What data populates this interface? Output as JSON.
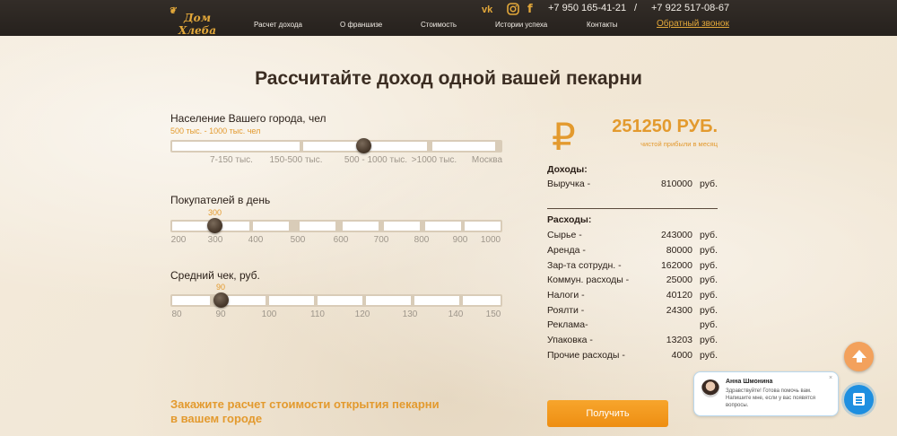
{
  "header": {
    "logo": {
      "text": "Дом Хлеба",
      "sub": ""
    },
    "nav": [
      "Расчет дохода",
      "О франшизе",
      "Стоимость",
      "Истории успеха",
      "Контакты"
    ],
    "social": [
      "vk-icon",
      "instagram-icon",
      "facebook-icon"
    ],
    "phone1": "+7 950 165-41-21",
    "separator": "/",
    "phone2": "+7 922 517-08-67",
    "callback": "Обратный звонок"
  },
  "title": "Рассчитайте доход одной вашей пекарни",
  "sliders": {
    "population": {
      "label": "Население Вашего города, чел",
      "selected": "500 тыс. - 1000 тыс. чел",
      "ticks": [
        "7-150 тыс.",
        "150-500 тыс.",
        "500 - 1000 тыс.",
        ">1000 тыс.",
        "Москва"
      ],
      "position_index": 2
    },
    "customers": {
      "label": "Покупателей в день",
      "selected": "300",
      "ticks": [
        "200",
        "300",
        "400",
        "500",
        "600",
        "700",
        "800",
        "900",
        "1000"
      ],
      "value": 300
    },
    "check": {
      "label": "Средний чек, руб.",
      "selected": "90",
      "ticks": [
        "80",
        "90",
        "100",
        "110",
        "120",
        "130",
        "140",
        "150"
      ],
      "value": 90
    }
  },
  "cta_text": "Закажите расчет стоимости открытия пекарни в вашем городе",
  "summary": {
    "currency_symbol": "₽",
    "profit": "251250 РУБ.",
    "profit_caption": "чистой прибыли в месяц",
    "income_title": "Доходы:",
    "income": [
      {
        "name": "Выручка -",
        "value": "810000",
        "cur": "руб."
      }
    ],
    "expenses_title": "Расходы:",
    "expenses": [
      {
        "name": "Сырье -",
        "value": "243000",
        "cur": "руб."
      },
      {
        "name": "Аренда -",
        "value": "80000",
        "cur": "руб."
      },
      {
        "name": "Зар-та сотрудн. -",
        "value": "162000",
        "cur": "руб."
      },
      {
        "name": "Коммун. расходы -",
        "value": "25000",
        "cur": "руб."
      },
      {
        "name": "Налоги -",
        "value": "40120",
        "cur": "руб."
      },
      {
        "name": "Роялти -",
        "value": "24300",
        "cur": "руб."
      },
      {
        "name": "Реклама-",
        "value": "",
        "cur": "руб."
      },
      {
        "name": "Упаковка -",
        "value": "13203",
        "cur": "руб."
      },
      {
        "name": "Прочие расходы -",
        "value": "4000",
        "cur": "руб."
      }
    ],
    "button": "Получить"
  },
  "chat": {
    "name": "Анна Шмонина",
    "message": "Здравствуйте! Готова помочь вам. Напишите мне, если у вас появятся вопросы.",
    "close": "×"
  },
  "colors": {
    "accent": "#e39a2e",
    "button": "#f39a1c",
    "header": "#2b2622",
    "chat": "#1e8fe0"
  }
}
